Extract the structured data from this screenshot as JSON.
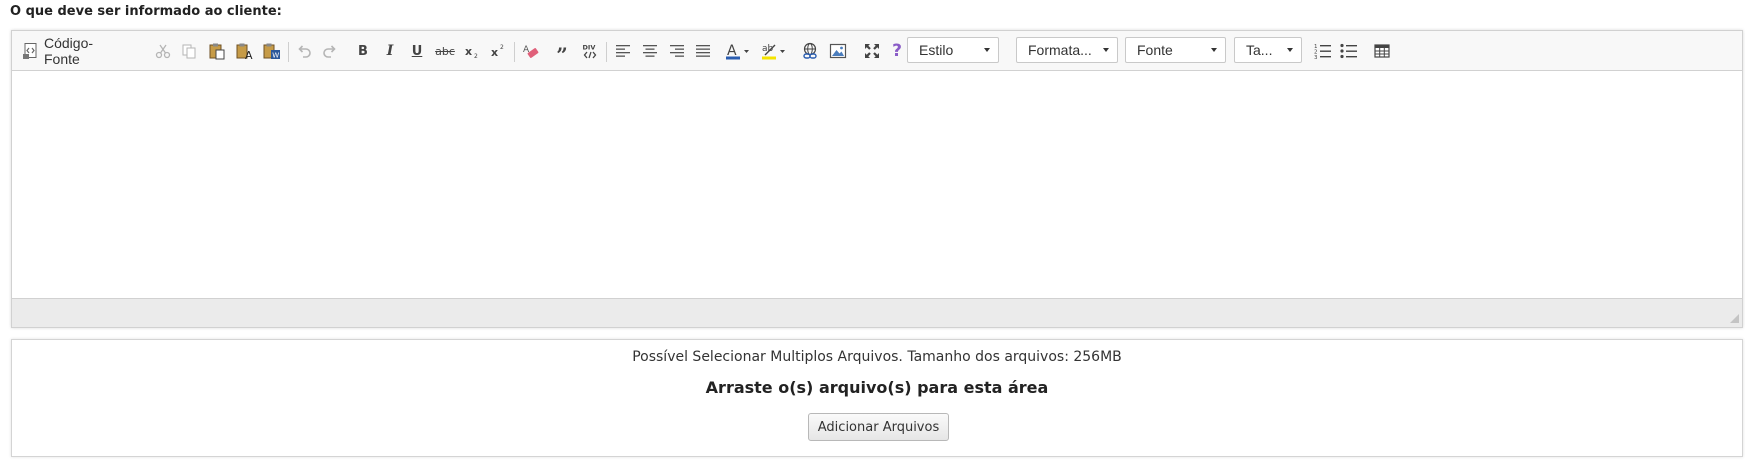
{
  "field_label": "O que deve ser informado ao cliente:",
  "toolbar": {
    "source_label": "Código-Fonte",
    "style_combo": "Estilo",
    "format_combo": "Formata...",
    "font_combo": "Fonte",
    "size_combo": "Ta...",
    "colors": {
      "text_color_bar": "#2a5db0",
      "bg_color_bar": "#f5e400",
      "help_icon": "#8a5cc7",
      "icon_gray": "#555555",
      "icon_disabled": "#b5b5b5"
    }
  },
  "dropzone": {
    "info": "Possível Selecionar Multiplos Arquivos. Tamanho dos arquivos: 256MB",
    "title": "Arraste o(s) arquivo(s) para esta área",
    "button_label": "Adicionar Arquivos"
  }
}
